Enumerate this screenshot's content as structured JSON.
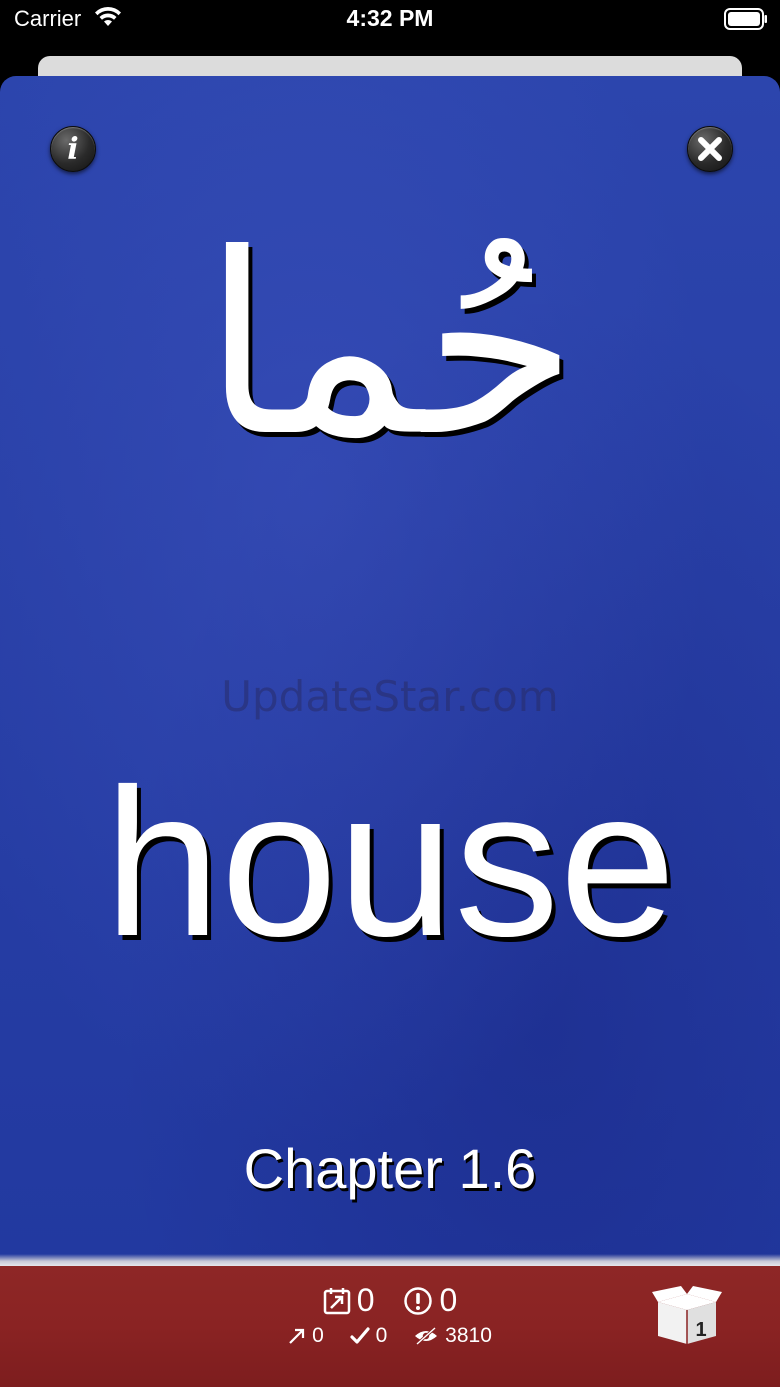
{
  "status_bar": {
    "carrier": "Carrier",
    "time": "4:32 PM"
  },
  "card": {
    "arabic_word": "حُما",
    "watermark": "UpdateStar.com",
    "english_word": "house",
    "chapter": "Chapter 1.6",
    "info_icon_glyph": "i",
    "colors": {
      "card_blue": "#2a42a8",
      "stats_red": "#8a2323"
    }
  },
  "stats": {
    "due": "0",
    "problem": "0",
    "learned": "0",
    "correct": "0",
    "seen": "3810",
    "box_number": "1"
  },
  "icons": {
    "info": "info-icon",
    "close": "close-icon",
    "due": "calendar-arrow-icon",
    "problem": "exclamation-circle-icon",
    "learned": "arrow-up-right-icon",
    "correct": "checkmark-icon",
    "seen": "eye-slash-icon",
    "box": "box-icon"
  }
}
